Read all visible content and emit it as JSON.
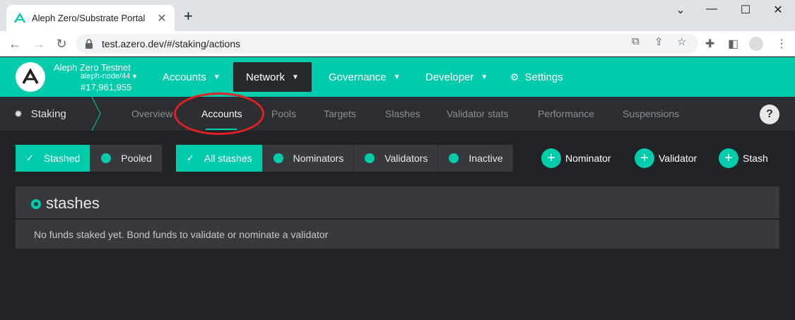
{
  "browser": {
    "tab_title": "Aleph Zero/Substrate Portal",
    "url": "test.azero.dev/#/staking/actions"
  },
  "header": {
    "chain_name": "Aleph Zero Testnet",
    "node_name": "aleph-node/44",
    "block_number": "#17,961,955",
    "menu": [
      {
        "label": "Accounts",
        "icon": "caret-down-icon"
      },
      {
        "label": "Network",
        "icon": "caret-down-icon",
        "active": true
      },
      {
        "label": "Governance",
        "icon": "caret-down-icon"
      },
      {
        "label": "Developer",
        "icon": "caret-down-icon"
      },
      {
        "label": "Settings",
        "icon": "gears-icon"
      }
    ]
  },
  "subnav": {
    "section": "Staking",
    "tabs": [
      "Overview",
      "Accounts",
      "Pools",
      "Targets",
      "Slashes",
      "Validator stats",
      "Performance",
      "Suspensions"
    ],
    "active_tab": "Accounts",
    "help": "?"
  },
  "filters": {
    "type_toggle": [
      "Stashed",
      "Pooled"
    ],
    "stash_filter": [
      "All stashes",
      "Nominators",
      "Validators",
      "Inactive"
    ],
    "actions": [
      "Nominator",
      "Validator",
      "Stash"
    ]
  },
  "stashes_panel": {
    "title": "stashes",
    "empty_message": "No funds staked yet. Bond funds to validate or nominate a validator"
  },
  "colors": {
    "accent": "#00ccab",
    "background": "#222326",
    "annotation": "#e41f26"
  }
}
